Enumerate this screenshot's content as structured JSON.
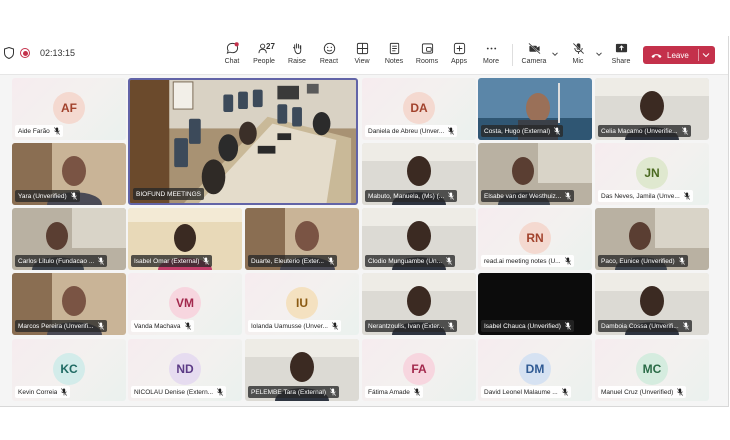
{
  "toolbar": {
    "timer": "02:13:15",
    "buttons": [
      {
        "id": "chat",
        "label": "Chat"
      },
      {
        "id": "people",
        "label": "People",
        "count": "27"
      },
      {
        "id": "raise",
        "label": "Raise"
      },
      {
        "id": "react",
        "label": "React"
      },
      {
        "id": "view",
        "label": "View"
      },
      {
        "id": "notes",
        "label": "Notes"
      },
      {
        "id": "rooms",
        "label": "Rooms"
      },
      {
        "id": "apps",
        "label": "Apps"
      },
      {
        "id": "more",
        "label": "More"
      },
      {
        "id": "camera",
        "label": "Camera"
      },
      {
        "id": "mic",
        "label": "Mic"
      },
      {
        "id": "share",
        "label": "Share"
      }
    ],
    "leave_label": "Leave"
  },
  "featured": {
    "name": "BIOFUND MEETINGS"
  },
  "participants": [
    {
      "name": "Aide Farão",
      "initials": "AF",
      "type": "avatar",
      "bg": "#f4d9d0",
      "fg": "#a2422c"
    },
    {
      "name": "Daniela de Abreu (Unver...",
      "initials": "DA",
      "type": "avatar",
      "bg": "#f4d9d0",
      "fg": "#a2422c"
    },
    {
      "name": "Costa, Hugo (External)",
      "type": "video",
      "scene": "sky"
    },
    {
      "name": "Celia Macamo (Unverifie...",
      "type": "video",
      "scene": "light"
    },
    {
      "name": "Yara (Unverified)",
      "type": "video",
      "scene": "room"
    },
    {
      "name": "Mabuto, Manuela, (Ms) (...",
      "type": "video",
      "scene": "light"
    },
    {
      "name": "Elsabe van der Westhuiz...",
      "type": "video",
      "scene": "office"
    },
    {
      "name": "Das Neves, Jamila (Unve...",
      "initials": "JN",
      "type": "avatar",
      "bg": "#dfe8cf",
      "fg": "#4c6b22"
    },
    {
      "name": "Carlos Litulo (Fundacao ...",
      "type": "video",
      "scene": "office"
    },
    {
      "name": "Isabel Omar (External)",
      "type": "video",
      "scene": "warm"
    },
    {
      "name": "Duarte, Eleuterio (Exter...",
      "type": "video",
      "scene": "room"
    },
    {
      "name": "Clodio Munguambe (Un...",
      "type": "video",
      "scene": "light"
    },
    {
      "name": "read.ai meeting notes (U...",
      "initials": "RN",
      "type": "avatar",
      "bg": "#f4d9d0",
      "fg": "#a2422c"
    },
    {
      "name": "Paco, Eunice (Unverified)",
      "type": "video",
      "scene": "office"
    },
    {
      "name": "Marcos Pereira (Unverifi...",
      "type": "video",
      "scene": "room"
    },
    {
      "name": "Vanda Machava",
      "initials": "VM",
      "type": "avatar",
      "bg": "#f7d6df",
      "fg": "#a3294d"
    },
    {
      "name": "Iolanda Uamusse (Unver...",
      "initials": "IU",
      "type": "avatar",
      "bg": "#f4e1c0",
      "fg": "#8a5a12"
    },
    {
      "name": "Nerantzoulis, Ivan (Exter...",
      "type": "video",
      "scene": "light"
    },
    {
      "name": "Isabel Chauca (Unverified)",
      "type": "video",
      "scene": "black"
    },
    {
      "name": "Damboia Cossa (Unverifi...",
      "type": "video",
      "scene": "light"
    },
    {
      "name": "Kevin Correia",
      "initials": "KC",
      "type": "avatar",
      "bg": "#d3ecea",
      "fg": "#1f6a63"
    },
    {
      "name": "NICOLAU Denise (Extern...",
      "initials": "ND",
      "type": "avatar",
      "bg": "#e6dcf0",
      "fg": "#5b3a86"
    },
    {
      "name": "PELEMBE Tara (External)",
      "type": "video",
      "scene": "light"
    },
    {
      "name": "Fátima Amade",
      "initials": "FA",
      "type": "avatar",
      "bg": "#f7d6df",
      "fg": "#a3294d"
    },
    {
      "name": "David Leonel Malaume ...",
      "initials": "DM",
      "type": "avatar",
      "bg": "#d6e2f2",
      "fg": "#2f5a94"
    },
    {
      "name": "Manuel Cruz (Unverified)",
      "initials": "MC",
      "type": "avatar",
      "bg": "#d5ecdf",
      "fg": "#2a6b47"
    }
  ]
}
